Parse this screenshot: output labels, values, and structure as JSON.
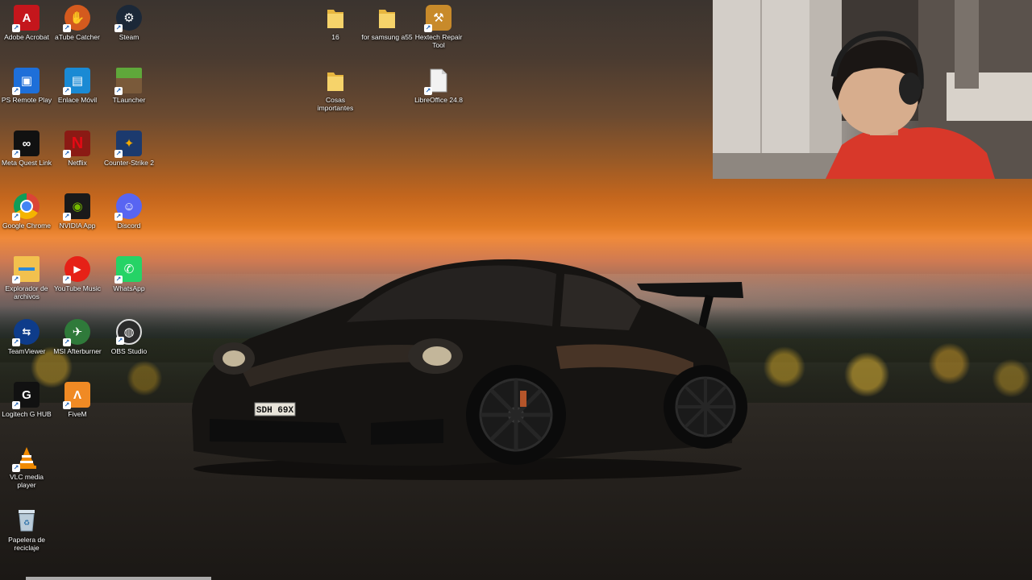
{
  "desktop": {
    "icons": [
      {
        "label": "Adobe Acrobat",
        "icon": "adobe-acrobat-icon",
        "color": "#c4161c"
      },
      {
        "label": "aTube Catcher",
        "icon": "atube-catcher-icon",
        "color": "#d45a1e"
      },
      {
        "label": "Steam",
        "icon": "steam-icon",
        "color": "#1b2838"
      },
      {
        "label": "PS Remote Play",
        "icon": "ps-remote-play-icon",
        "color": "#1e6fd9"
      },
      {
        "label": "Enlace Móvil",
        "icon": "enlace-movil-icon",
        "color": "#1a8ad4"
      },
      {
        "label": "TLauncher",
        "icon": "tlauncher-icon",
        "color": "#4e8a2e"
      },
      {
        "label": "Meta Quest Link",
        "icon": "meta-quest-link-icon",
        "color": "#111111"
      },
      {
        "label": "Netflix",
        "icon": "netflix-icon",
        "color": "#8b1a14"
      },
      {
        "label": "Counter-Strike 2",
        "icon": "counter-strike-2-icon",
        "color": "#1c3a6e"
      },
      {
        "label": "Google Chrome",
        "icon": "google-chrome-icon",
        "color": "#ffffff"
      },
      {
        "label": "NVIDIA App",
        "icon": "nvidia-app-icon",
        "color": "#1a1a1a"
      },
      {
        "label": "Discord",
        "icon": "discord-icon",
        "color": "#5865f2"
      },
      {
        "label": "Explorador de archivos",
        "icon": "file-explorer-icon",
        "color": "#f2c14e"
      },
      {
        "label": "YouTube Music",
        "icon": "youtube-music-icon",
        "color": "#e62117"
      },
      {
        "label": "WhatsApp",
        "icon": "whatsapp-icon",
        "color": "#25d366"
      },
      {
        "label": "TeamViewer",
        "icon": "teamviewer-icon",
        "color": "#0e8ee9"
      },
      {
        "label": "MSI Afterburner",
        "icon": "msi-afterburner-icon",
        "color": "#2f7a3a"
      },
      {
        "label": "OBS Studio",
        "icon": "obs-studio-icon",
        "color": "#2b2b2b"
      },
      {
        "label": "Logitech G HUB",
        "icon": "logitech-g-hub-icon",
        "color": "#111111"
      },
      {
        "label": "FiveM",
        "icon": "fivem-icon",
        "color": "#f08a24"
      },
      {
        "label": "VLC media player",
        "icon": "vlc-icon",
        "color": "#f08a00"
      },
      {
        "label": "Papelera de reciclaje",
        "icon": "recycle-bin-icon",
        "color": "#a8c4d8"
      },
      {
        "label": "16",
        "icon": "folder-icon",
        "color": "#f2c14e"
      },
      {
        "label": "for samsung a55",
        "icon": "folder-icon",
        "color": "#f2c14e"
      },
      {
        "label": "Hextech Repair Tool",
        "icon": "hextech-repair-tool-icon",
        "color": "#c88a2a"
      },
      {
        "label": "Cosas importantes",
        "icon": "folder-icon",
        "color": "#f2c14e"
      },
      {
        "label": "LibreOffice 24.8",
        "icon": "libreoffice-icon",
        "color": "#e8e8e8"
      }
    ]
  },
  "wallpaper": {
    "license_plate": "SDH 69X"
  }
}
